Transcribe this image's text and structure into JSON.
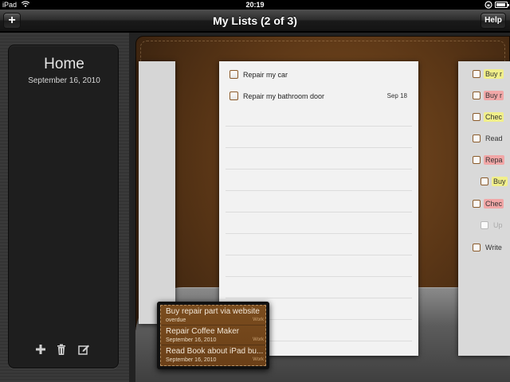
{
  "status_bar": {
    "device": "iPad",
    "time": "20:19",
    "battery_level": 0.9
  },
  "nav": {
    "title": "My Lists (2 of 3)",
    "add_label": "+",
    "help_label": "Help"
  },
  "left_card": {
    "title": "Home",
    "date": "September 16, 2010"
  },
  "center_list": {
    "items": [
      {
        "label": "Repair my car",
        "date": ""
      },
      {
        "label": "Repair my bathroom door",
        "date": "Sep 18"
      }
    ]
  },
  "right_list": {
    "items": [
      {
        "label": "Buy r",
        "style": "yellow"
      },
      {
        "label": "Buy r",
        "style": "red"
      },
      {
        "label": "Chec",
        "style": "yellow-underline"
      },
      {
        "label": "Read",
        "style": ""
      },
      {
        "label": "Repa",
        "style": "red"
      },
      {
        "label": "Buy",
        "style": "yellow",
        "indent": true
      },
      {
        "label": "Chec",
        "style": "red"
      },
      {
        "label": "Up",
        "style": "done",
        "indent": true
      },
      {
        "label": "Write",
        "style": ""
      }
    ]
  },
  "popup": {
    "items": [
      {
        "title": "Buy repair part via website",
        "sub": "overdue",
        "category": "Work"
      },
      {
        "title": "Repair Coffee Maker",
        "sub": "September 16, 2010",
        "category": "Work"
      },
      {
        "title": "Read Book about iPad bu...",
        "sub": "September 16, 2010",
        "category": "Work"
      }
    ]
  },
  "colors": {
    "leather": "#5a3616",
    "highlight_yellow": "#f1ef8a",
    "highlight_red": "#f1a7a7"
  }
}
